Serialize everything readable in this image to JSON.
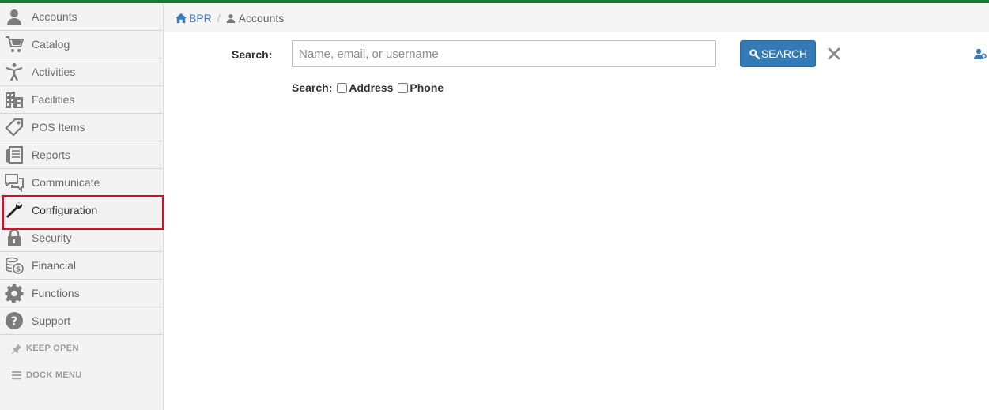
{
  "sidebar": {
    "items": [
      {
        "label": "Accounts",
        "icon": "user-icon"
      },
      {
        "label": "Catalog",
        "icon": "cart-icon"
      },
      {
        "label": "Activities",
        "icon": "person-activity-icon"
      },
      {
        "label": "Facilities",
        "icon": "building-icon"
      },
      {
        "label": "POS Items",
        "icon": "tag-icon"
      },
      {
        "label": "Reports",
        "icon": "reports-icon"
      },
      {
        "label": "Communicate",
        "icon": "chat-icon"
      },
      {
        "label": "Configuration",
        "icon": "wrench-icon"
      },
      {
        "label": "Security",
        "icon": "lock-icon"
      },
      {
        "label": "Financial",
        "icon": "coins-icon"
      },
      {
        "label": "Functions",
        "icon": "gear-icon"
      },
      {
        "label": "Support",
        "icon": "question-icon"
      }
    ],
    "active_label": "Configuration",
    "keep_open": "KEEP OPEN",
    "dock_menu": "DOCK MENU"
  },
  "breadcrumb": {
    "home": "BPR",
    "separator": "/",
    "current": "Accounts"
  },
  "search": {
    "label": "Search:",
    "placeholder": "Name, email, or username",
    "value": "",
    "button_label": "SEARCH",
    "options_label": "Search:",
    "options": [
      {
        "label": "Address",
        "checked": false
      },
      {
        "label": "Phone",
        "checked": false
      }
    ]
  },
  "colors": {
    "topbar": "#1f7a3a",
    "accent": "#337ab7",
    "highlight_border": "#c0172c"
  }
}
